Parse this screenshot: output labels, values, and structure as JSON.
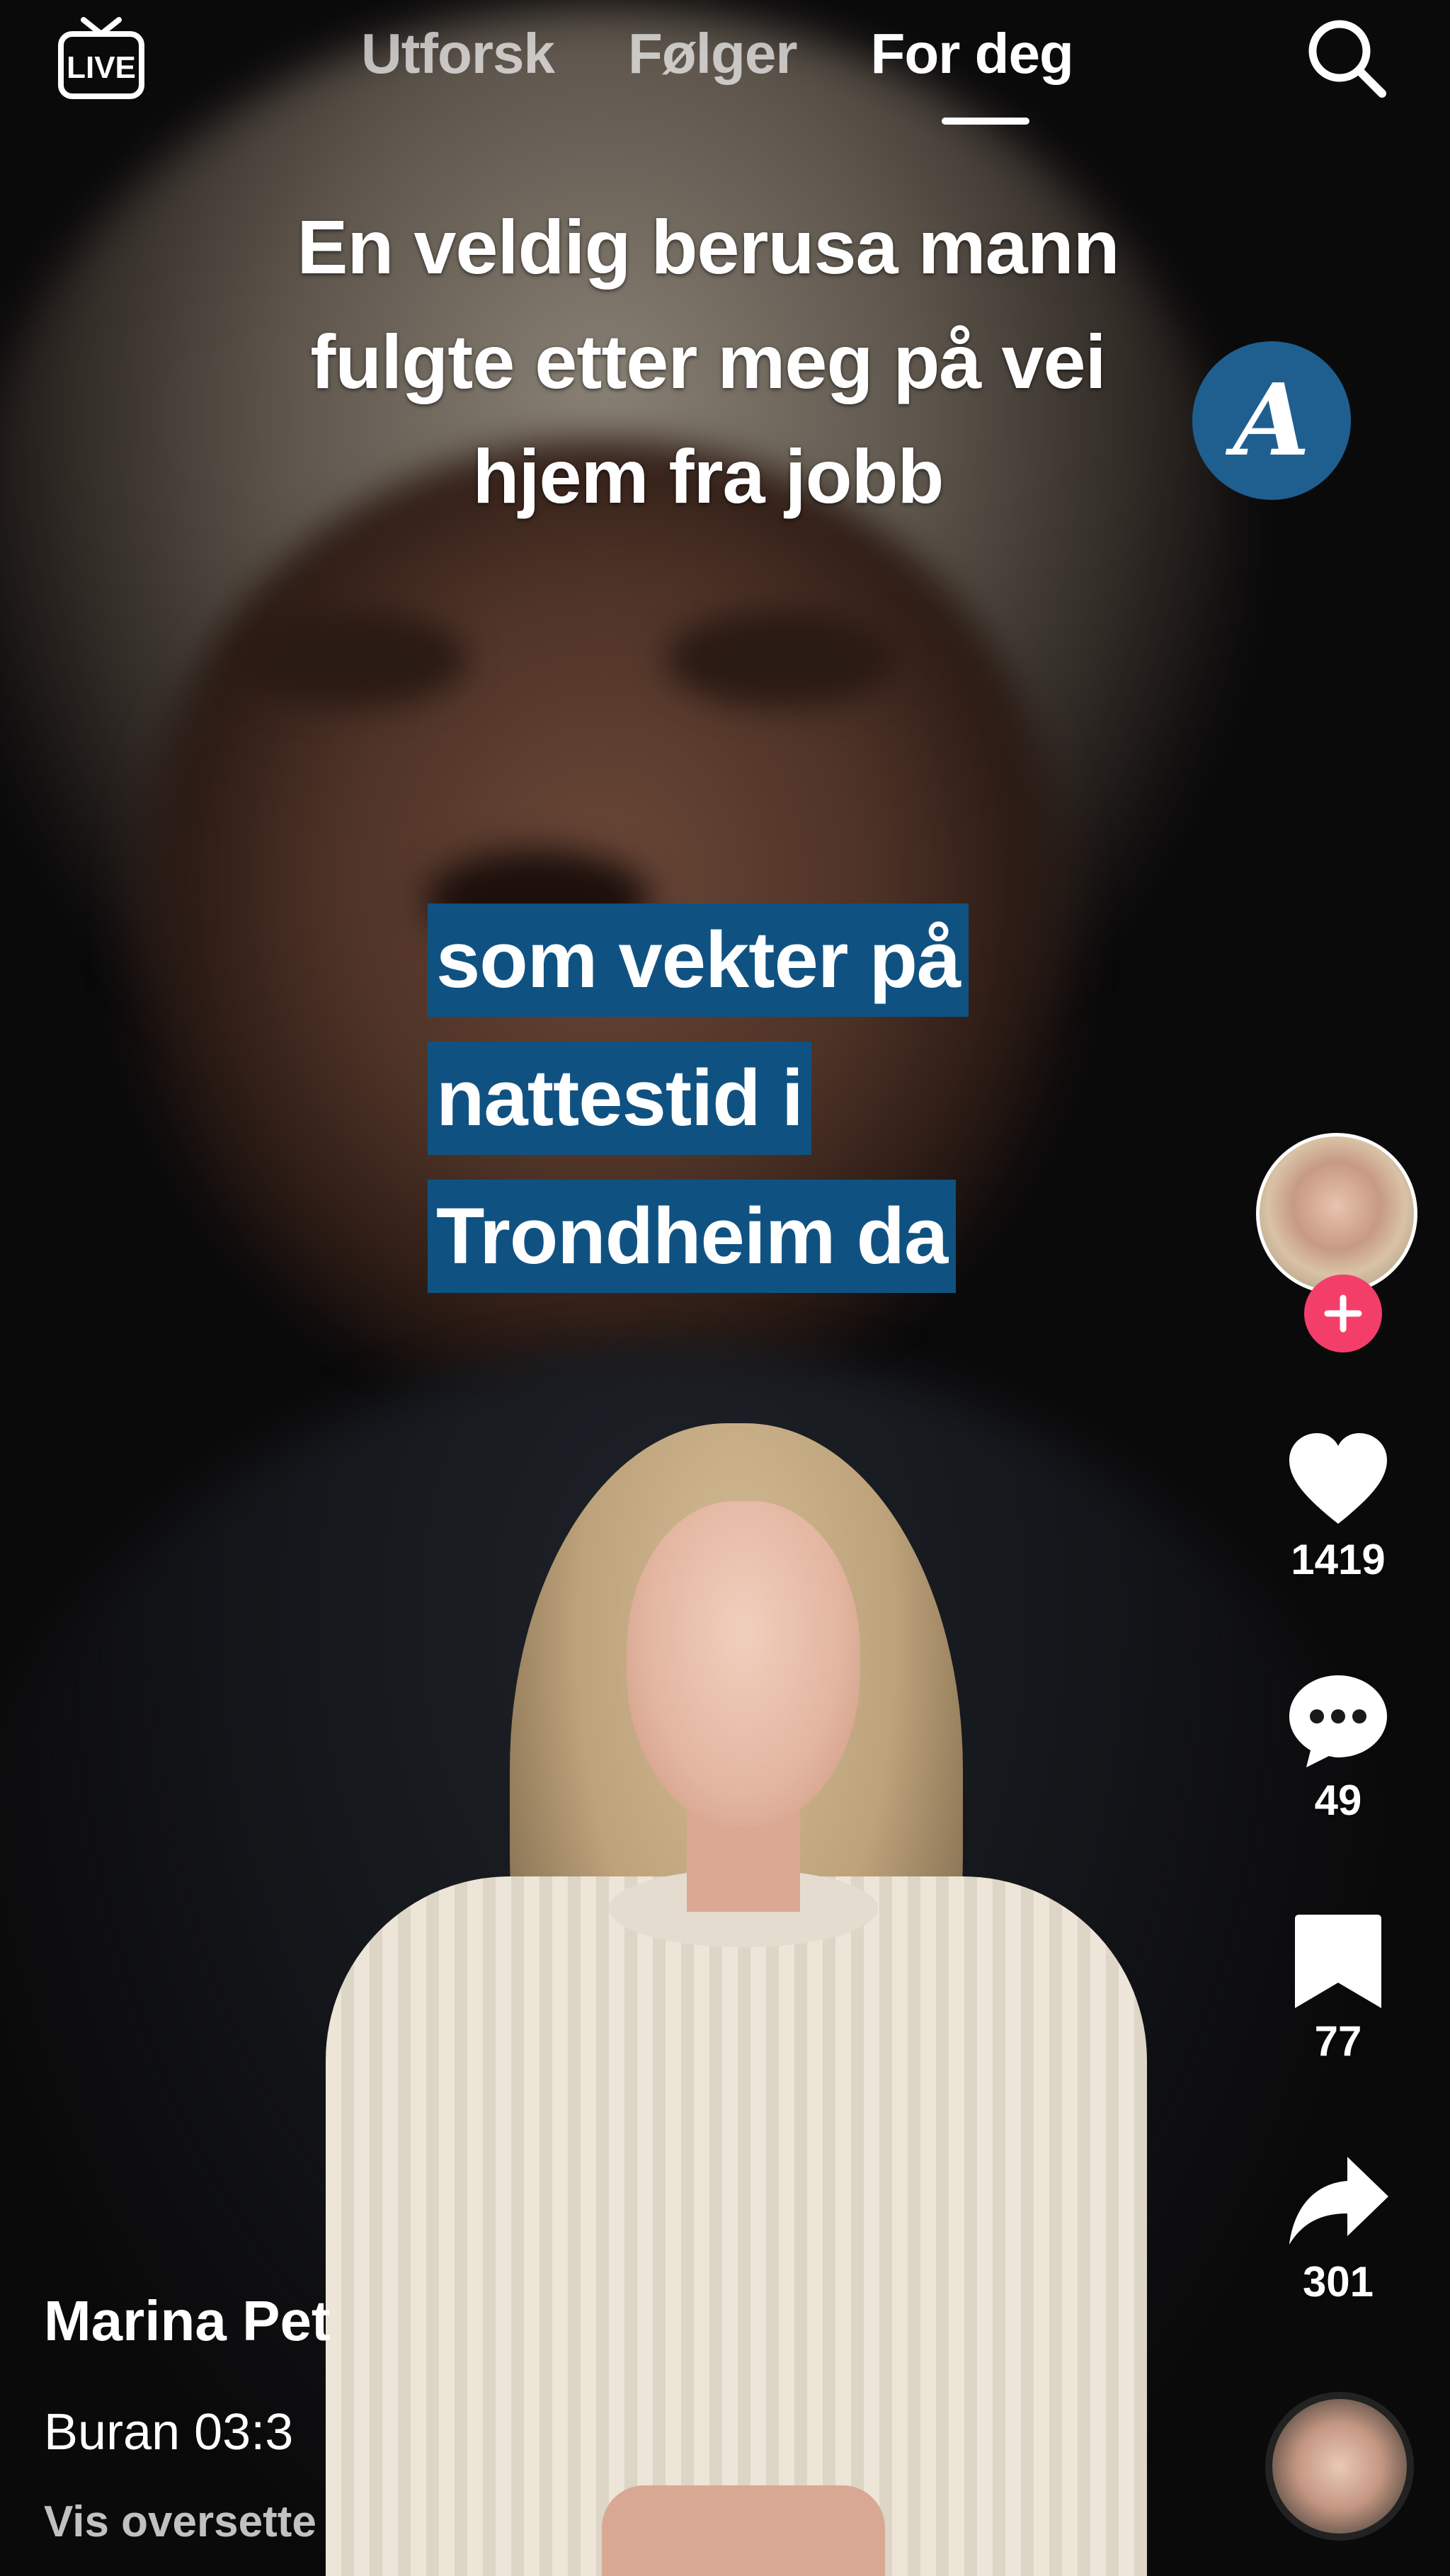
{
  "topbar": {
    "live_label": "LIVE",
    "tabs": [
      {
        "label": "Utforsk",
        "active": false
      },
      {
        "label": "Følger",
        "active": false
      },
      {
        "label": "For deg",
        "active": true
      }
    ],
    "search_icon": "search-icon"
  },
  "video": {
    "headline_lines": [
      "En veldig berusa mann",
      "fulgte etter meg på vei",
      "hjem fra jobb"
    ],
    "brand_logo_letter": "A",
    "subtitle_lines": [
      "som vekter på",
      "nattestid i",
      "Trondheim da"
    ],
    "subtitle_bg_color": "#0f5282"
  },
  "actions": {
    "follow_icon": "plus-icon",
    "like": {
      "icon": "heart-icon",
      "count": "1419"
    },
    "comments": {
      "icon": "comment-icon",
      "count": "49"
    },
    "bookmarks": {
      "icon": "bookmark-icon",
      "count": "77"
    },
    "shares": {
      "icon": "share-icon",
      "count": "301"
    }
  },
  "post": {
    "username": "Marina Pet",
    "description": "Buran 03:3",
    "translate_label": "Vis oversette"
  },
  "colors": {
    "accent_pink": "#f43e6a",
    "brand_blue": "#1f5f8f"
  }
}
